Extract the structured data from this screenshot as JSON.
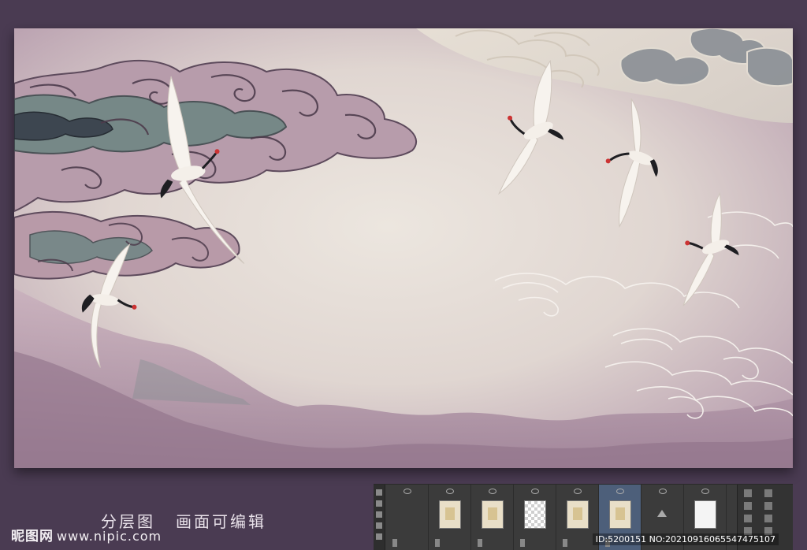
{
  "caption": {
    "part1": "分层图",
    "part2": "画面可编辑"
  },
  "watermark": {
    "site_name": "昵图网",
    "url": "www.nipic.com"
  },
  "image_meta": "ID:5200151 NO:20210916065547475107",
  "colors": {
    "page_background": "#4a3b52",
    "artwork_paper": "#e6ded6",
    "cloud_mauve": "#b89aa8",
    "cloud_teal": "#6f8684",
    "panel_background": "#3b3b3b"
  },
  "icons": {
    "crane": "crane-icon",
    "cloud": "auspicious-cloud-icon"
  }
}
